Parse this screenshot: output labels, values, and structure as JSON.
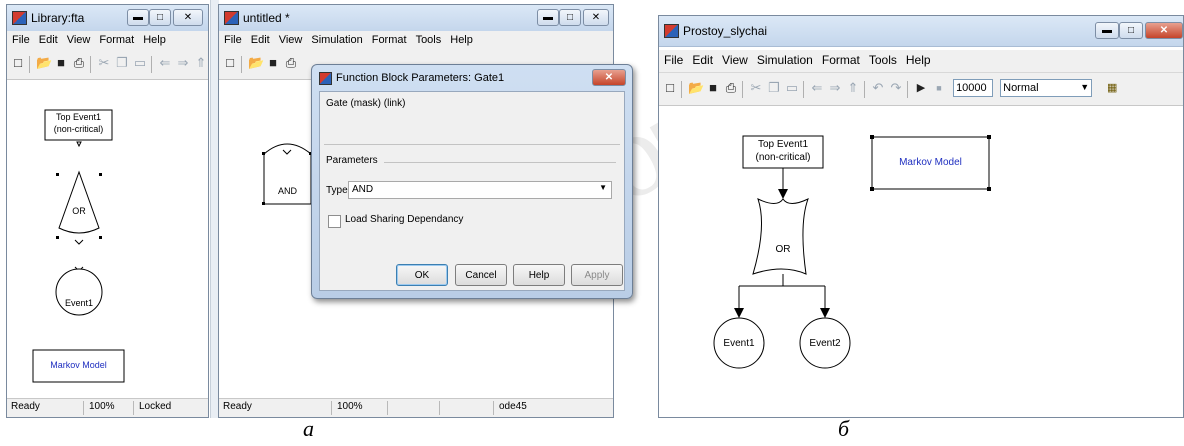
{
  "left_window": {
    "title": "Library:fta",
    "menu": [
      "File",
      "Edit",
      "View",
      "Format",
      "Help"
    ],
    "blocks": {
      "top_event_line1": "Top Event1",
      "top_event_line2": "(non-critical)",
      "or_gate": "OR",
      "event": "Event1",
      "markov": "Markov Model"
    },
    "status": {
      "ready": "Ready",
      "zoom": "100%",
      "locked": "Locked"
    }
  },
  "middle_window": {
    "title": "untitled *",
    "menu": [
      "File",
      "Edit",
      "View",
      "Simulation",
      "Format",
      "Tools",
      "Help"
    ],
    "blocks": {
      "and_gate": "AND"
    },
    "status": {
      "ready": "Ready",
      "zoom": "100%",
      "solver": "ode45"
    }
  },
  "dialog": {
    "title": "Function Block Parameters: Gate1",
    "header": "Gate (mask) (link)",
    "section": "Parameters",
    "type_label": "Type",
    "type_value": "AND",
    "checkbox_label": "Load Sharing Dependancy",
    "buttons": {
      "ok": "OK",
      "cancel": "Cancel",
      "help": "Help",
      "apply": "Apply"
    }
  },
  "right_window": {
    "title": "Prostoy_slychai",
    "menu": [
      "File",
      "Edit",
      "View",
      "Simulation",
      "Format",
      "Tools",
      "Help"
    ],
    "stop_time": "10000",
    "sim_mode": "Normal",
    "blocks": {
      "top_event_line1": "Top Event1",
      "top_event_line2": "(non-critical)",
      "markov": "Markov Model",
      "or_gate": "OR",
      "event1": "Event1",
      "event2": "Event2"
    }
  },
  "captions": {
    "a": "а",
    "b": "б"
  },
  "watermark": "библиотека",
  "colors": {
    "markov_text": "#1f2fc0",
    "title_bar": "#c4d6ec",
    "close_button": "#c5442a"
  }
}
